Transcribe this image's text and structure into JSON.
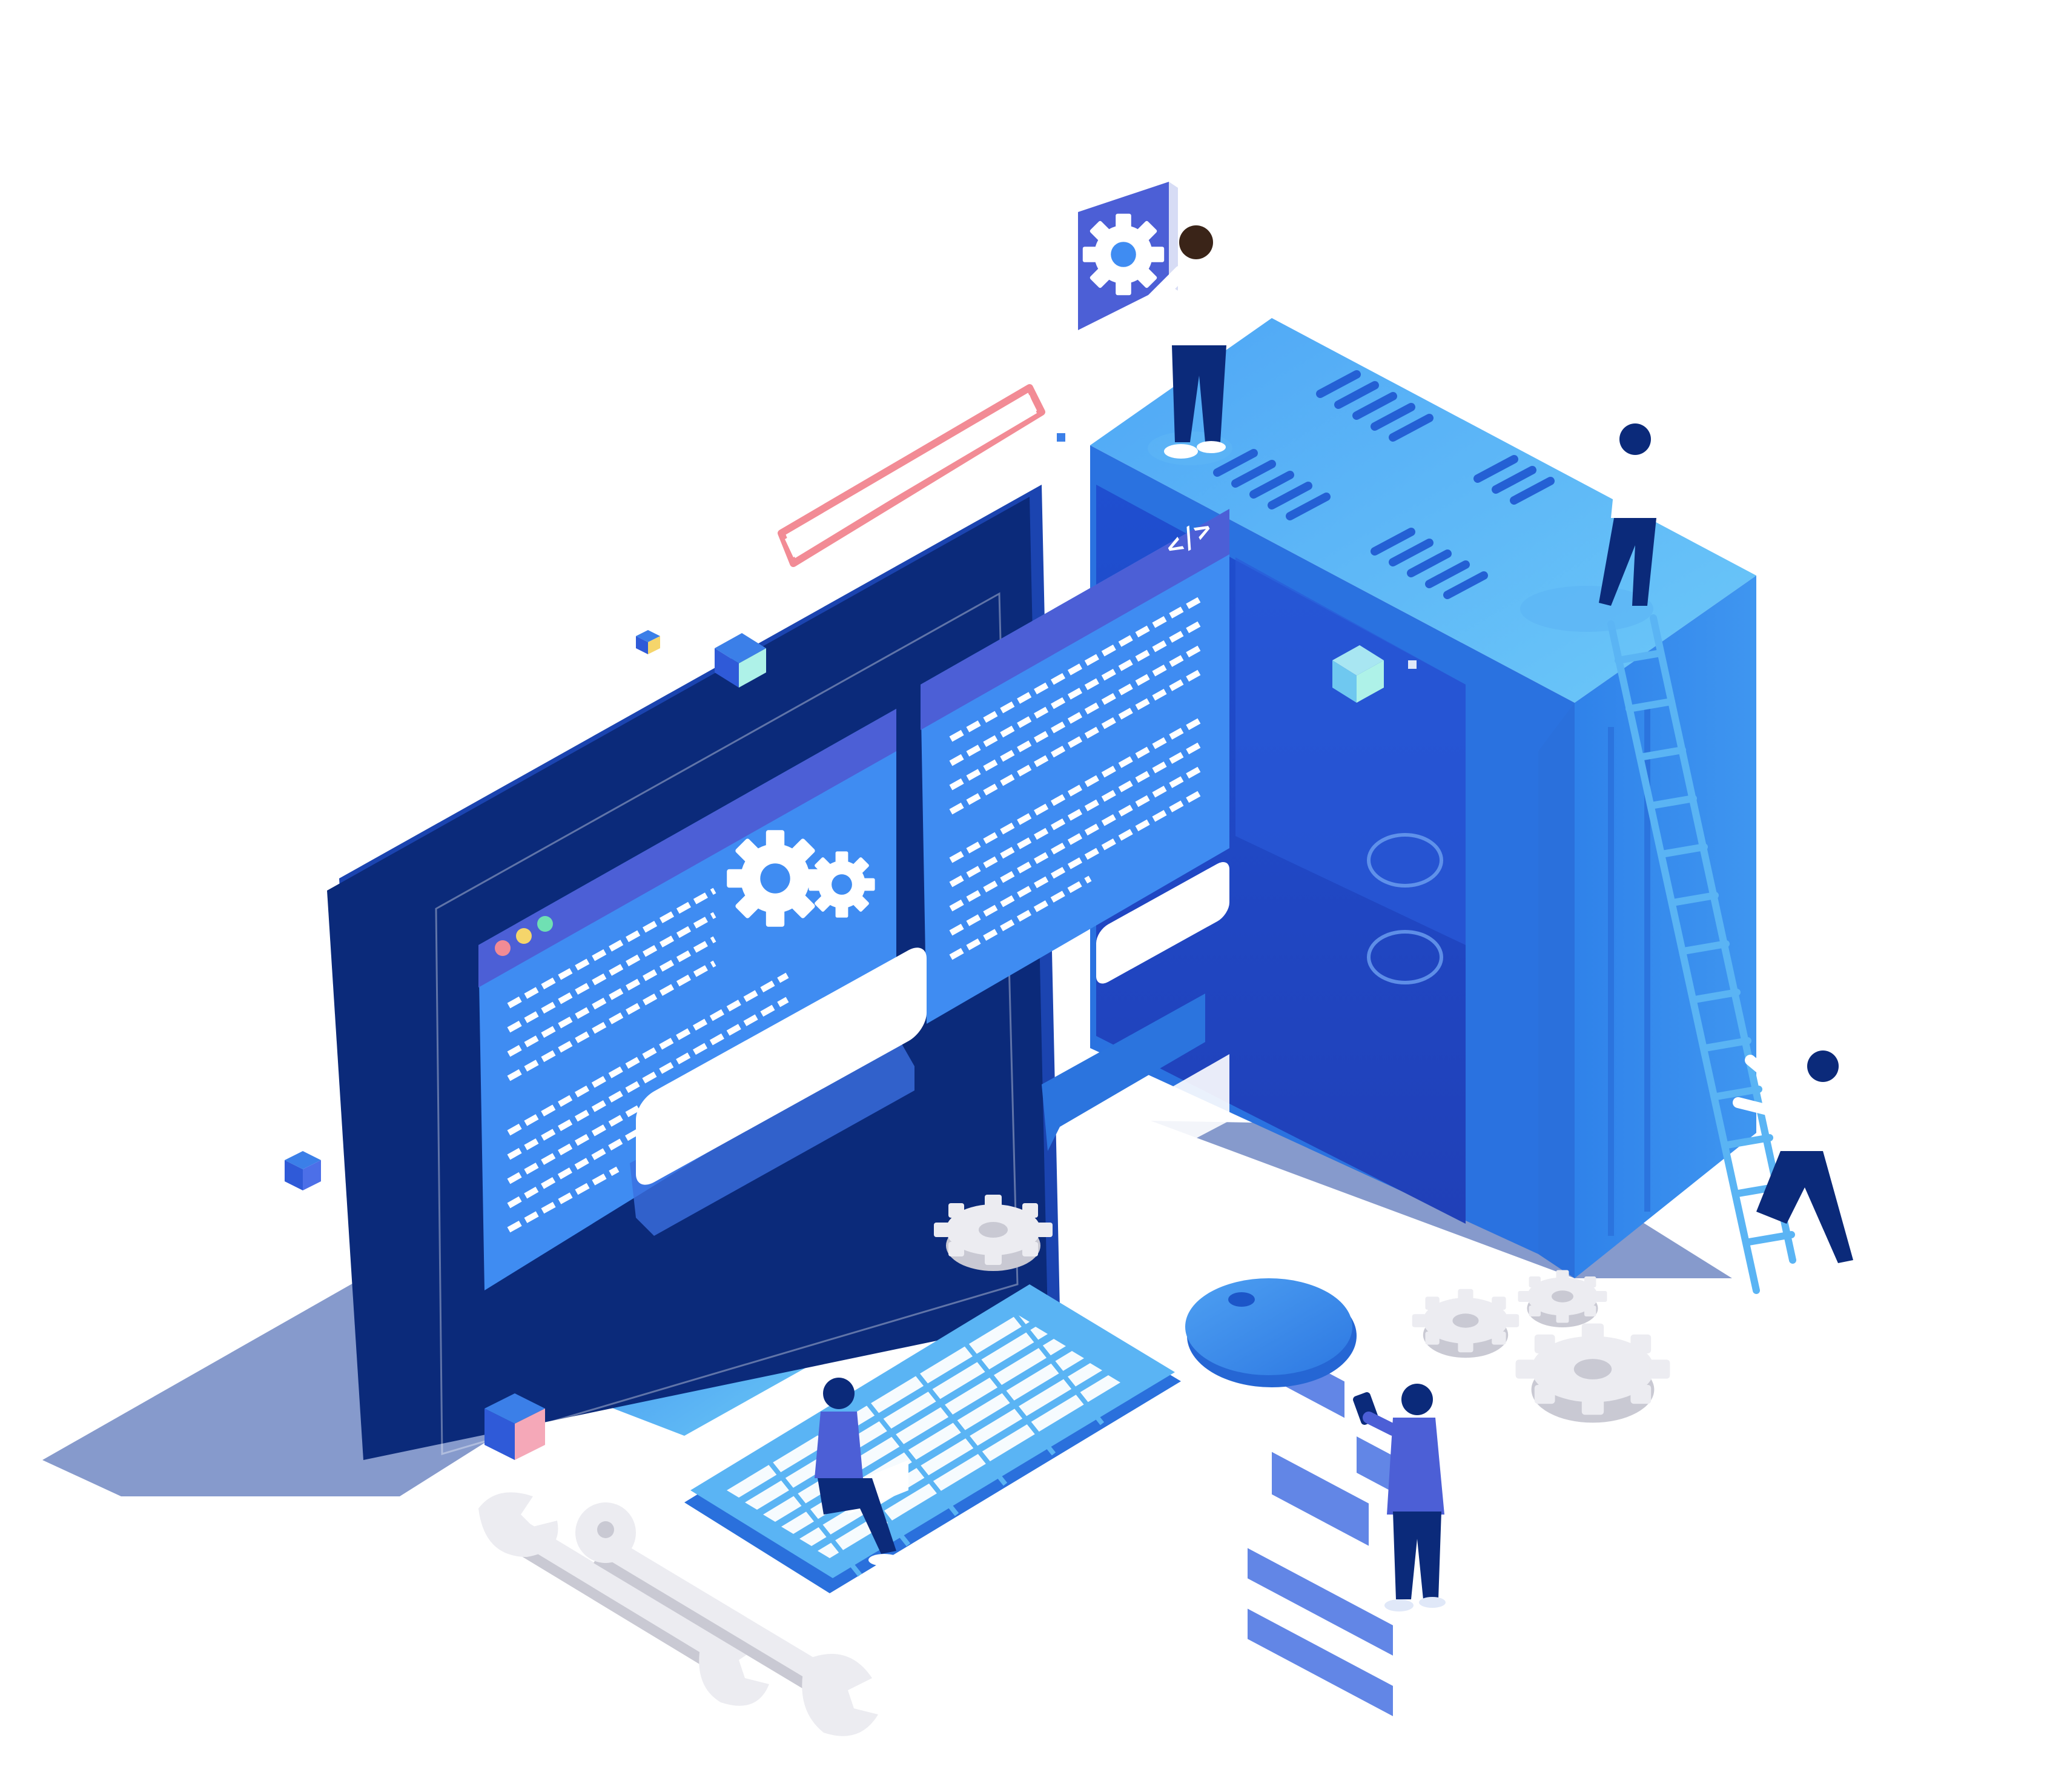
{
  "code_window": {
    "tag": "</>"
  },
  "colors": {
    "background": "#ffffff",
    "primary_blue": "#2f7fe8",
    "light_blue": "#5db5f5",
    "dark_navy": "#0b2a7a",
    "mid_blue": "#3b6fe0",
    "panel_blue": "#3f8cf2",
    "indigo": "#4c5fd6",
    "gray_gear": "#e4e4ea",
    "pink_accent": "#f28b95",
    "shadow": "#7f95c9",
    "mint": "#aef2e8"
  },
  "icons": [
    "gear-icon",
    "code-brackets-icon",
    "window-controls-icon",
    "wrench-icon",
    "mouse-icon",
    "keyboard-icon",
    "ladder-icon",
    "smartphone-icon",
    "laptop-icon"
  ]
}
